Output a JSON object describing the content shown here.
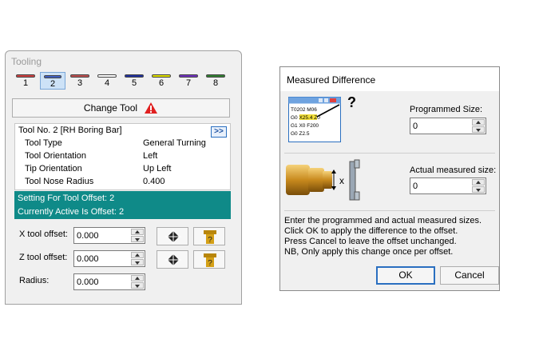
{
  "tooling": {
    "title": "Tooling",
    "tabs": [
      {
        "num": "1",
        "color": "#d04040"
      },
      {
        "num": "2",
        "color": "#4060c0"
      },
      {
        "num": "3",
        "color": "#c05050"
      },
      {
        "num": "4",
        "color": "#ffffff"
      },
      {
        "num": "5",
        "color": "#2030a0"
      },
      {
        "num": "6",
        "color": "#e0e000"
      },
      {
        "num": "7",
        "color": "#7030c0"
      },
      {
        "num": "8",
        "color": "#308030"
      }
    ],
    "active_tab": "2",
    "change_tool_label": "Change Tool",
    "tool_name": "Tool No. 2 [RH Boring Bar]",
    "expand_label": ">>",
    "rows": [
      {
        "label": "Tool Type",
        "value": "General Turning"
      },
      {
        "label": "Tool Orientation",
        "value": "Left"
      },
      {
        "label": "Tip Orientation",
        "value": "Up Left"
      },
      {
        "label": "Tool Nose Radius",
        "value": "0.400"
      }
    ],
    "offset_line1": "Setting For Tool Offset: 2",
    "offset_line2": "Currently Active Is Offset: 2",
    "x_label": "X tool offset:",
    "x_value": "0.000",
    "z_label": "Z tool offset:",
    "z_value": "0.000",
    "radius_label": "Radius:",
    "radius_value": "0.000"
  },
  "dialog": {
    "title": "Measured Difference",
    "program_lines": [
      "T0202 M06",
      "G0 X25.4 Z0",
      "G1 X0 F200",
      "G0 Z2.5"
    ],
    "question_mark": "?",
    "dimension_label": "x",
    "programmed_label": "Programmed Size:",
    "programmed_value": "0",
    "actual_label": "Actual measured size:",
    "actual_value": "0",
    "help_lines": [
      "Enter the programmed  and actual measured sizes.",
      "Click OK to apply the difference to the offset.",
      "Press Cancel to leave the offset unchanged.",
      "NB, Only apply this change once per offset."
    ],
    "ok_label": "OK",
    "cancel_label": "Cancel"
  },
  "colors": {
    "banner": "#0f8a88",
    "accent": "#2a6fc0",
    "warning": "#e02020"
  }
}
